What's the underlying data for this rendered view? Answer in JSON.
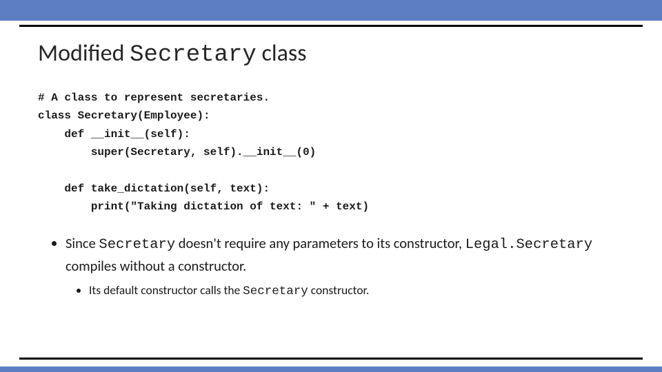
{
  "title": {
    "pre": "Modified ",
    "mono": "Secretary",
    "post": " class"
  },
  "code": {
    "l1": "# A class to represent secretaries.",
    "l2": "class Secretary(Employee):",
    "l3": "    def __init__(self):",
    "l4": "        super(Secretary, self).__init__(0)",
    "l5": "",
    "l6": "    def take_dictation(self, text):",
    "l7": "        print(\"Taking dictation of text: \" + text)"
  },
  "bullet1": {
    "t1": "Since ",
    "m1": "Secretary",
    "t2": " doesn't require any parameters to its constructor, ",
    "m2": "Legal.Secretary",
    "t3": " compiles without a constructor."
  },
  "bullet2": {
    "t1": "Its default constructor calls the ",
    "m1": "Secretary",
    "t2": " constructor."
  }
}
